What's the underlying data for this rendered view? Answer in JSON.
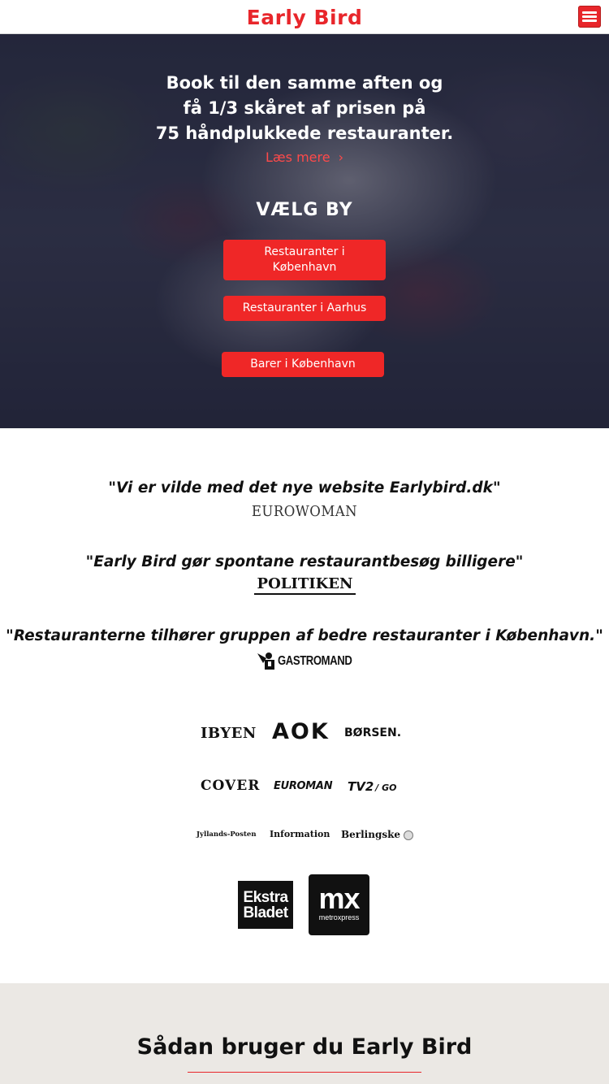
{
  "header": {
    "brand": "Early Bird",
    "menu_icon": "hamburger-menu-icon",
    "accent_color": "#e8262b"
  },
  "hero": {
    "headline_line1": "Book til den samme aften og",
    "headline_line2": "få 1/3 skåret af prisen på",
    "headline_line3": "75 håndplukkede restauranter.",
    "read_more": "Læs mere",
    "read_more_icon": "chevron-right-icon",
    "choose_city": "VÆLG BY",
    "buttons": {
      "kbh": "Restauranter i København",
      "aarhus": "Restauranter i Aarhus",
      "barer": "Barer i København"
    },
    "button_color": "#ef2727"
  },
  "press": {
    "quotes": [
      {
        "text": "Vi er vilde med det nye website Earlybird.dk",
        "source": "EUROWOMAN"
      },
      {
        "text": "Early Bird gør spontane restaurantbesøg billigere",
        "source": "POLITIKEN"
      },
      {
        "text": "Restauranterne tilhører gruppen af bedre restauranter i København.",
        "source": "GASTROMAND"
      }
    ]
  },
  "media_logos": {
    "ibyen": "IBYEN",
    "aok": "AOK",
    "borsen": "BØRSEN.",
    "cover": "COVER",
    "euroman": "EUROMAN",
    "tv2": "TV2",
    "tv2_go": "/ GO",
    "jp": "Jyllands-Posten",
    "information": "Information",
    "berlingske": "Berlingske",
    "ekstra_line1": "Ekstra",
    "ekstra_line2": "Bladet",
    "mx_big": "mx",
    "mx_small": "metroxpress"
  },
  "howto": {
    "title": "Sådan bruger du Early Bird",
    "background": "#ebe8e4"
  }
}
